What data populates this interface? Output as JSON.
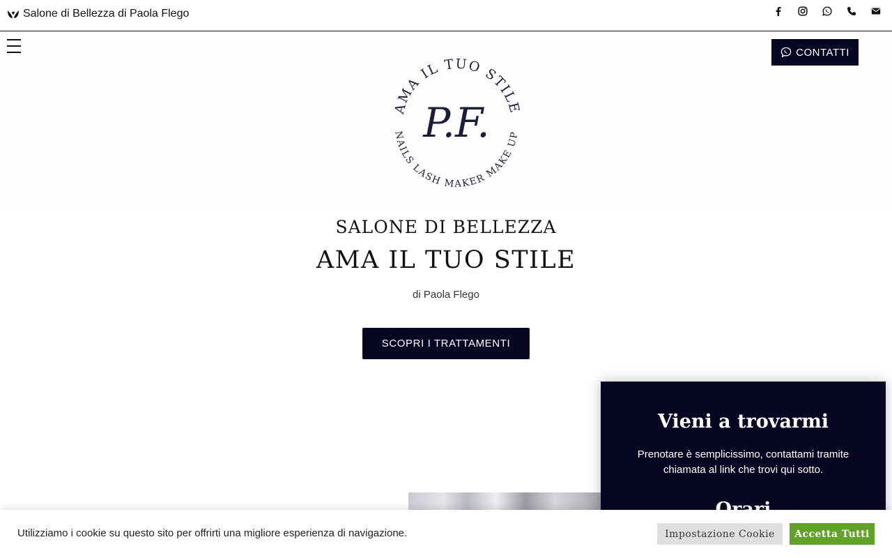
{
  "topbar": {
    "brand_label": "Salone di Bellezza di Paola Flego",
    "brand_icon": "hands-heart-icon",
    "social": [
      "facebook-icon",
      "instagram-icon",
      "whatsapp-icon",
      "phone-icon",
      "envelope-icon"
    ]
  },
  "header": {
    "menu_icon": "hamburger-menu-icon",
    "contact_label": "CONTATTI",
    "contact_icon": "chat-bubble-icon"
  },
  "logo": {
    "monogram": "P.F.",
    "top_arc": "AMA IL TUO STILE",
    "bottom_arc": "NAILS LASH MAKER MAKE UP"
  },
  "hero": {
    "title_small": "SALONE DI BELLEZZA",
    "title_large": "AMA IL TUO STILE",
    "subtitle": "di Paola Flego",
    "cta_label": "SCOPRI I TRATTAMENTI"
  },
  "side_panel": {
    "title": "Vieni a trovarmi",
    "text": "Prenotare è semplicissimo, contattami tramite chiamata al link che trovi qui sotto.",
    "next_heading_partial": "Orari"
  },
  "cookie": {
    "message": "Utilizziamo i cookie su questo sito per offrirti una migliore esperienza di navigazione.",
    "settings_label": "Impostazione Cookie",
    "accept_label": "Accetta Tutti"
  },
  "colors": {
    "navy": "#070723",
    "accept_green": "#61a229",
    "settings_grey": "#dedfe0"
  }
}
